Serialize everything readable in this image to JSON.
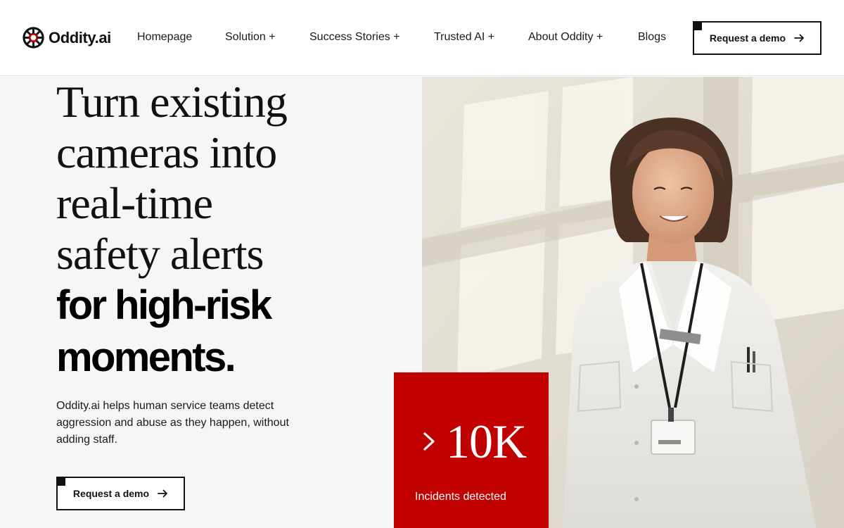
{
  "brand": {
    "name": "Oddity.ai",
    "accent_color": "#c10000",
    "logo_icon": "aperture-logo-icon"
  },
  "nav": {
    "items": [
      {
        "label": "Homepage"
      },
      {
        "label": "Solution +"
      },
      {
        "label": "Success Stories +"
      },
      {
        "label": "Trusted AI +"
      },
      {
        "label": "About Oddity +"
      },
      {
        "label": "Blogs"
      }
    ],
    "cta_label": "Request a demo",
    "cta_icon": "arrow-right-icon"
  },
  "hero": {
    "headline_light": [
      "Turn existing",
      "cameras into",
      "real-time",
      "safety alerts"
    ],
    "headline_bold": [
      "for high-risk",
      "moments."
    ],
    "description": "Oddity.ai helps human service teams detect aggression and abuse as they happen, without adding staff.",
    "cta_label": "Request a demo",
    "image_subject": "smiling woman in white lab coat with lanyard"
  },
  "stat": {
    "value": "10K",
    "prefix_icon": "chevron-right-icon",
    "label": "Incidents detected",
    "color": "#c10000"
  }
}
